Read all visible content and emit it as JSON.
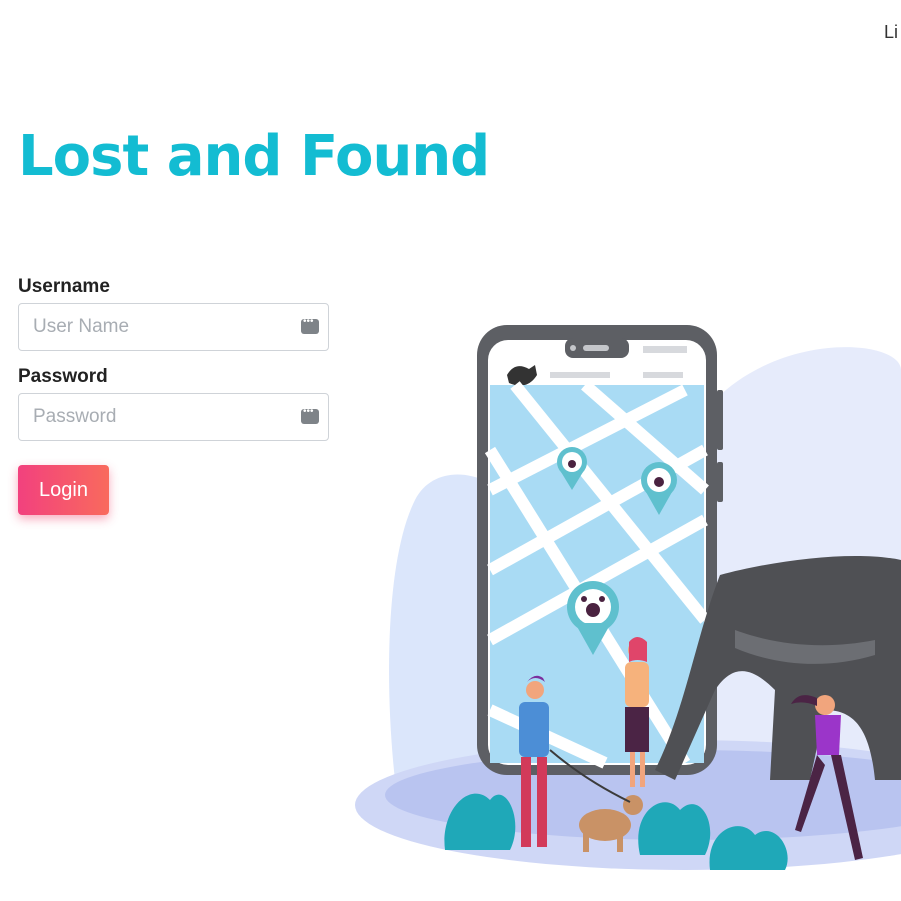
{
  "header": {
    "top_link_label": "Li"
  },
  "page": {
    "title": "Lost and Found"
  },
  "form": {
    "username": {
      "label": "Username",
      "placeholder": "User Name",
      "value": ""
    },
    "password": {
      "label": "Password",
      "placeholder": "Password",
      "value": ""
    },
    "login_label": "Login"
  },
  "icons": {
    "field_icon": "password-manager-key-icon"
  },
  "colors": {
    "title": "#13bcd2",
    "button_gradient_start": "#f2417e",
    "button_gradient_end": "#f96a5d"
  }
}
